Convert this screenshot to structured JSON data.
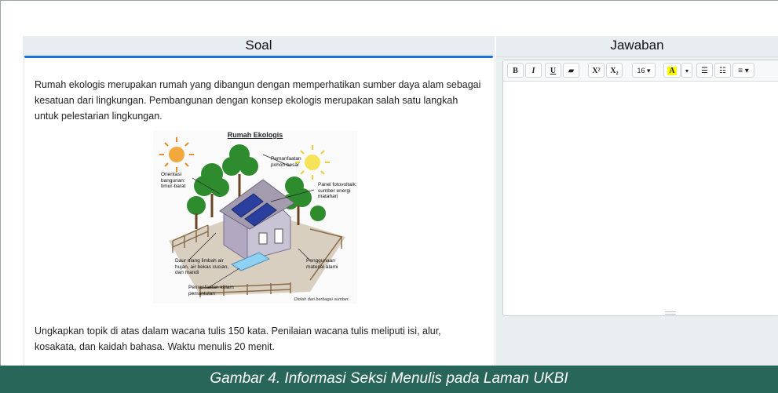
{
  "headers": {
    "soal": "Soal",
    "jawaban": "Jawaban"
  },
  "question": {
    "intro": "Rumah ekologis merupakan rumah yang dibangun dengan memperhatikan sumber daya alam sebagai kesatuan dari lingkungan. Pembangunan dengan konsep ekologis merupakan salah satu langkah untuk pelestarian lingkungan.",
    "instruction": "Ungkapkan topik di atas dalam wacana tulis 150 kata. Penilaian wacana tulis meliputi isi, alur, kosakata, dan kaidah bahasa. Waktu menulis 20 menit."
  },
  "figure": {
    "title": "Rumah Ekologis",
    "labels": {
      "orientasi": "Orientasi bangunan: timur-barat",
      "pemanfaatan_pohon": "Pemanfaatan pohon besar",
      "panel": "Panel fotovoltaik: sumber energi matahari",
      "daur_ulang": "Daur ulang limbah air hujan, air bekas cucian, dan mandi",
      "penggunaan": "Penggunaan material alami",
      "kolam": "Pemanfaatan kolam pemantulan"
    },
    "source": "Diolah dari berbagai sumber."
  },
  "editor": {
    "bold": "B",
    "italic": "I",
    "underline": "U",
    "eraser": "▰",
    "superscript": "X²",
    "subscript": "X₂",
    "font_size": "16",
    "highlight": "A",
    "bullet_list": "☰",
    "numbered_list": "☷",
    "align": "≡"
  },
  "caption": "Gambar 4. Informasi Seksi Menulis pada Laman UKBI"
}
